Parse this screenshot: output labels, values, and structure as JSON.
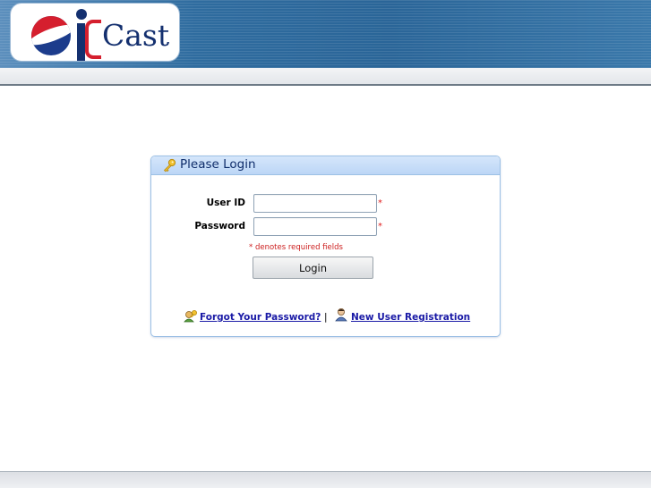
{
  "header": {
    "logo_text": "Cast",
    "logo_alt": "iCast"
  },
  "login": {
    "title": "Please Login",
    "user_id_label": "User ID",
    "password_label": "Password",
    "user_id_value": "",
    "password_value": "",
    "required_marker": "*",
    "required_note": "* denotes required fields",
    "login_button": "Login",
    "forgot_password_link": "Forgot Your Password?",
    "separator": "|",
    "new_user_link": "New User Registration"
  },
  "colors": {
    "banner_blue": "#2f6c9f",
    "link_blue": "#1a1aa6",
    "required_red": "#e02020",
    "panel_border": "#9cc0e5",
    "panel_header": "#c8def8"
  },
  "icons": [
    "key-icon",
    "forgot-password-icon",
    "new-user-icon"
  ]
}
